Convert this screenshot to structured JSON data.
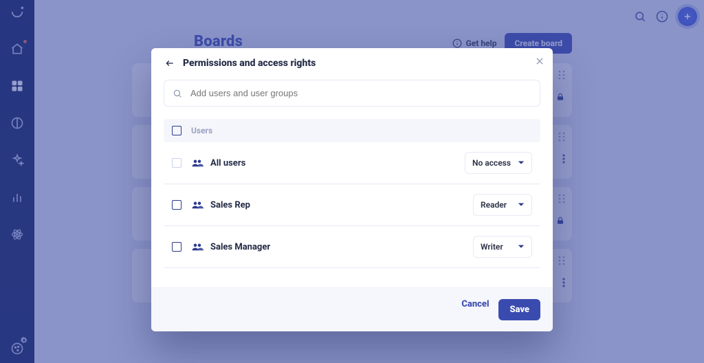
{
  "page": {
    "title": "Boards",
    "help_label": "Get help",
    "create_label": "Create board"
  },
  "nav": {
    "items": [
      {
        "name": "logo",
        "icon": "smile-icon"
      },
      {
        "name": "home",
        "icon": "home-icon",
        "notification": true
      },
      {
        "name": "apps",
        "icon": "grid-icon",
        "active": true
      },
      {
        "name": "half",
        "icon": "half-circle-icon"
      },
      {
        "name": "sparkle",
        "icon": "sparkle-icon"
      },
      {
        "name": "bars",
        "icon": "bars-icon"
      },
      {
        "name": "atom",
        "icon": "atom-icon"
      }
    ],
    "bottom": {
      "name": "cookie",
      "icon": "cookie-icon"
    }
  },
  "topbar": {
    "search_icon": "search-icon",
    "info_icon": "info-icon",
    "add_icon": "plus-icon"
  },
  "cards": [
    {
      "lock": true
    },
    {
      "lock": false
    },
    {
      "lock": true
    },
    {
      "lock": false
    }
  ],
  "modal": {
    "title": "Permissions and access rights",
    "search_placeholder": "Add users and user groups",
    "header_users_label": "Users",
    "cancel_label": "Cancel",
    "save_label": "Save",
    "rows": [
      {
        "name": "All users",
        "role": "No access",
        "checkbox": "light"
      },
      {
        "name": "Sales Rep",
        "role": "Reader",
        "checkbox": "solid"
      },
      {
        "name": "Sales Manager",
        "role": "Writer",
        "checkbox": "solid"
      }
    ]
  }
}
